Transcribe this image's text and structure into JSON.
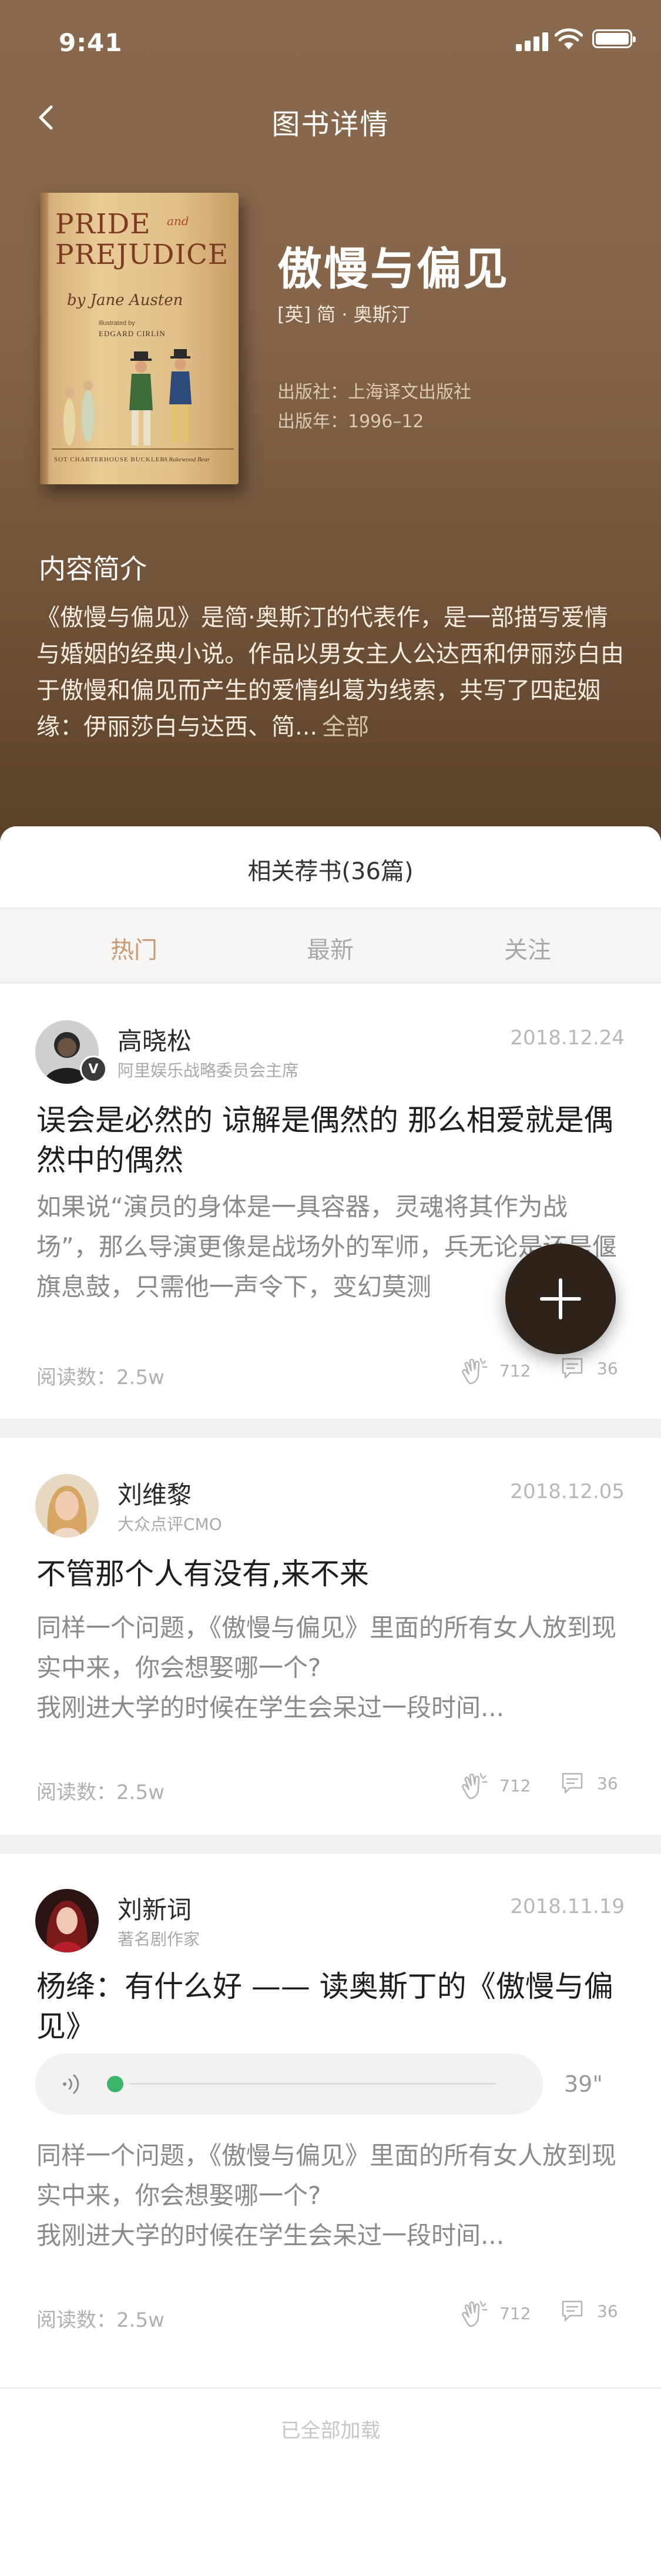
{
  "status_bar": {
    "time": "9:41"
  },
  "nav": {
    "title": "图书详情"
  },
  "cover": {
    "title_line1": "PRIDE",
    "title_and": "and",
    "title_line2": "PREJUDICE",
    "author_script": "by Jane Austen",
    "illustrated_by": "illustrated by",
    "illustrator": "EDGARD CIRLIN",
    "publisher_line": "SOT CHARTERHOUSE BUCKLER",
    "sign": "A Rakewood Bear"
  },
  "book": {
    "title": "傲慢与偏见",
    "author": "[英] 简 · 奥斯汀",
    "publisher": "出版社：上海译文出版社",
    "pub_year": "出版年：1996–12"
  },
  "intro": {
    "heading": "内容简介",
    "text": "《傲慢与偏见》是简·奥斯汀的代表作，是一部描写爱情与婚姻的经典小说。作品以男女主人公达西和伊丽莎白由于傲慢和偏见而产生的爱情纠葛为线索，共写了四起姻缘：伊丽莎白与达西、简...",
    "more": "全部"
  },
  "sheet": {
    "title": "相关荐书(36篇)"
  },
  "tabs": [
    {
      "label": "热门",
      "active": true
    },
    {
      "label": "最新",
      "active": false
    },
    {
      "label": "关注",
      "active": false
    }
  ],
  "posts": [
    {
      "author": "高晓松",
      "role": "阿里娱乐战略委员会主席",
      "date": "2018.12.24",
      "title": "误会是必然的   谅解是偶然的   那么相爱就是偶然中的偶然",
      "body": "如果说“演员的身体是一具容器，灵魂将其作为战场”，那么导演更像是战场外的军师，兵无论是还是偃旗息鼓，只需他一声令下，变幻莫测",
      "reads": "阅读数：2.5w",
      "claps": "712",
      "comments": "36",
      "verified_badge": "V"
    },
    {
      "author": "刘维黎",
      "role": "大众点评CMO",
      "date": "2018.12.05",
      "title": "不管那个人有没有,来不来",
      "body_line1": "同样一个问题，《傲慢与偏见》里面的所有女人放到现实中来，你会想娶哪一个?",
      "body_line2": "我刚进大学的时候在学生会呆过一段时间...",
      "reads": "阅读数：2.5w",
      "claps": "712",
      "comments": "36"
    },
    {
      "author": "刘新词",
      "role": "著名剧作家",
      "date": "2018.11.19",
      "title": "杨绛：有什么好   ——   读奥斯丁的《傲慢与偏见》",
      "audio_duration": "39\"",
      "audio_progress": 0.0,
      "body_line1": "同样一个问题，《傲慢与偏见》里面的所有女人放到现实中来，你会想娶哪一个?",
      "body_line2": "我刚进大学的时候在学生会呆过一段时间...",
      "reads": "阅读数：2.5w",
      "claps": "712",
      "comments": "36"
    }
  ],
  "footer": {
    "loaded_text": "已全部加载"
  },
  "colors": {
    "hero_brown": "#86664a",
    "active_tab": "#c79b72",
    "fab": "#2d231b",
    "audio_dot": "#3bb56a"
  },
  "icons": {
    "back": "chevron-left-icon",
    "clap": "clap-hands-icon",
    "comment": "comment-bubble-icon",
    "voice": "voice-wave-icon",
    "fab": "plus-icon"
  }
}
